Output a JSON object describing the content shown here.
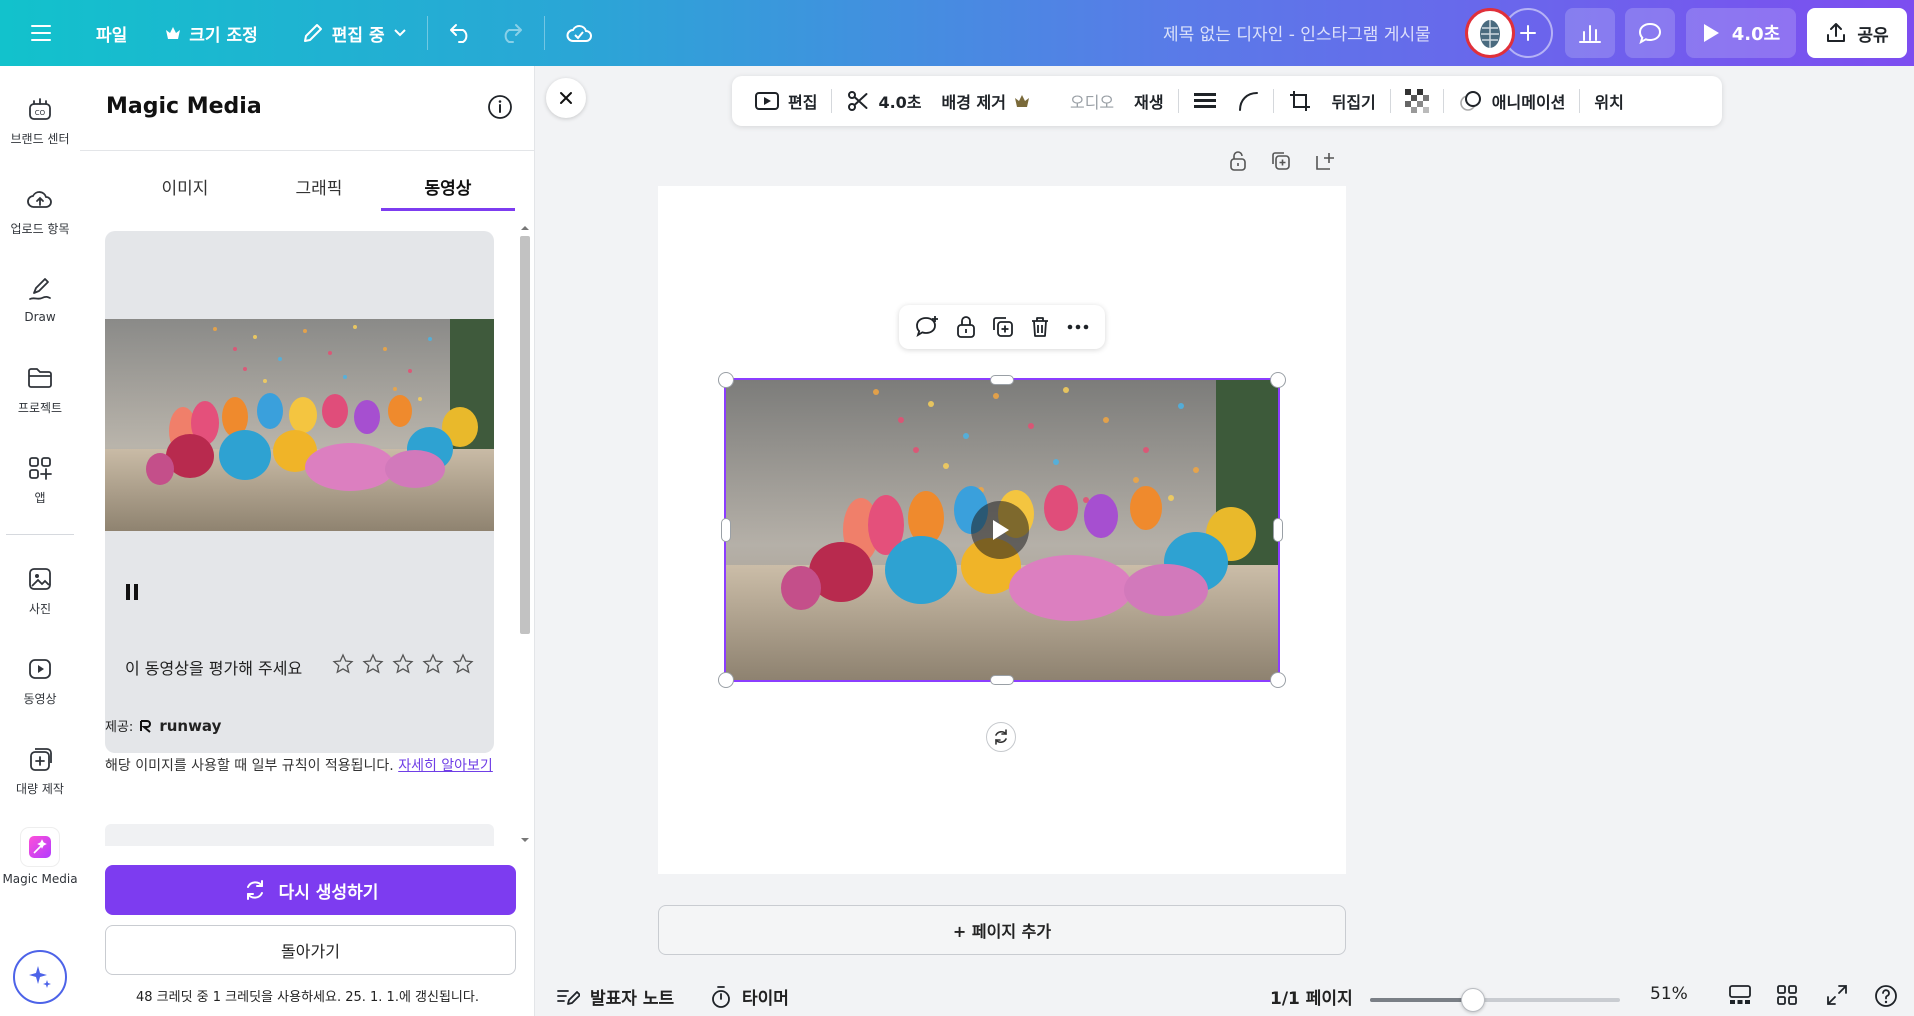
{
  "topbar": {
    "file_label": "파일",
    "resize_label": "크기 조정",
    "editing_label": "편집 중",
    "design_title": "제목 없는 디자인 - 인스타그램 게시물",
    "present_label": "4.0초",
    "share_label": "공유",
    "gradient_start": "#12c2cc",
    "gradient_end": "#7d4df0"
  },
  "rail": {
    "items": [
      {
        "label": "브랜드 센터",
        "icon": "brand-icon"
      },
      {
        "label": "업로드 항목",
        "icon": "upload-cloud-icon"
      },
      {
        "label": "Draw",
        "icon": "draw-pen-icon"
      },
      {
        "label": "프로젝트",
        "icon": "folder-icon"
      },
      {
        "label": "앱",
        "icon": "apps-grid-icon"
      },
      {
        "label": "사진",
        "icon": "photo-icon"
      },
      {
        "label": "동영상",
        "icon": "video-icon"
      },
      {
        "label": "대량 제작",
        "icon": "bulk-create-icon"
      },
      {
        "label": "Magic Media",
        "icon": "magic-media-icon"
      }
    ]
  },
  "panel": {
    "title": "Magic Media",
    "tabs": [
      {
        "label": "이미지"
      },
      {
        "label": "그래픽"
      },
      {
        "label": "동영상",
        "active": true
      }
    ],
    "rate_prompt": "이 동영상을 평가해 주세요",
    "provider_prefix": "제공:",
    "provider_name": "runway",
    "rules_text": "해당 이미지를 사용할 때 일부 규칙이 적용됩니다. ",
    "learn_more": "자세히 알아보기",
    "regenerate_label": "다시 생성하기",
    "back_label": "돌아가기",
    "credits_text": "48 크레딧 중 1 크레딧을 사용하세요. 25. 1. 1.에 갱신됩니다.",
    "accent": "#7d3cf0"
  },
  "context_toolbar": {
    "edit": "편집",
    "duration": "4.0초",
    "bg_remove": "배경 제거",
    "audio": "오디오",
    "playback": "재생",
    "flip": "뒤집기",
    "animation": "애니메이션",
    "position": "위치"
  },
  "canvas": {
    "add_page": "+ 페이지 추가",
    "selection_color": "#8b3dff"
  },
  "bottom": {
    "notes": "발표자 노트",
    "timer": "타이머",
    "page_indicator": "1/1 페이지",
    "zoom_percent": "51%",
    "zoom_value": 0.51
  }
}
